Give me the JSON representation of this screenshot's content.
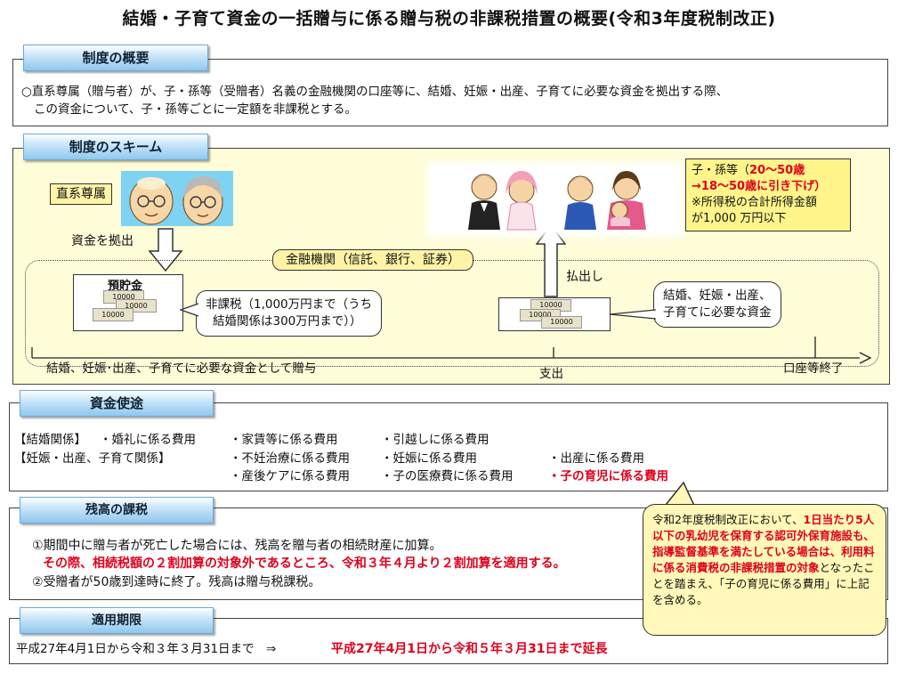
{
  "title": "結婚・子育て資金の一括贈与に係る贈与税の非課税措置の概要(令和3年度税制改正)",
  "overview": {
    "tab": "制度の概要",
    "line1": "○直系尊属（贈与者）が、子・孫等（受贈者）名義の金融機関の口座等に、結婚、妊娠・出産、子育てに必要な資金を拠出する際、",
    "line2": "この資金について、子・孫等ごとに一定額を非課税とする。"
  },
  "scheme": {
    "tab": "制度のスキーム",
    "direct_label": "直系尊属",
    "fund_label": "資金を拠出",
    "bank_label": "金融機関（信託、銀行、証券）",
    "savings_label": "預貯金",
    "bill_text": "10000",
    "nontax_line1": "非課税（1,000万円まで（うち",
    "nontax_line2": "結婚関係は300万円まで））",
    "payout_label": "払出し",
    "needs_line1": "結婚、妊娠・出産、",
    "needs_line2": "子育てに必要な資金",
    "recipient_prefix": "子・孫等（",
    "recipient_age": "20～50歳",
    "recipient_change": "→18～50歳に引き下げ）",
    "recipient_income1": "※所得税の合計所得金額",
    "recipient_income2": "が1,000 万円以下",
    "timeline_gift": "結婚、妊娠･出産、子育てに必要な資金として贈与",
    "timeline_payout": "支出",
    "timeline_end": "口座等終了"
  },
  "uses": {
    "tab": "資金使途",
    "marriage_label": "【結婚関係】",
    "marriage_items": [
      "・婚礼に係る費用",
      "・家賃等に係る費用",
      "・引越しに係る費用"
    ],
    "child_label": "【妊娠・出産、子育て関係】",
    "child_row1": [
      "・不妊治療に係る費用",
      "・妊娠に係る費用",
      "・出産に係る費用"
    ],
    "child_row2": [
      "・産後ケアに係る費用",
      "・子の医療費に係る費用"
    ],
    "child_new": "・子の育児に係る費用"
  },
  "balance": {
    "tab": "残高の課税",
    "item1": "①期間中に贈与者が死亡した場合には、残高を贈与者の相続財産に加算。",
    "item1_red": "その際、相続税額の２割加算の対象外であるところ、令和３年４月より２割加算を適用する。",
    "item2": "②受贈者が50歳到達時に終了。残高は贈与税課税。"
  },
  "period": {
    "tab": "適用期限",
    "text": "平成27年4月1日から令和３年３月31日まで　⇒",
    "extended": "平成27年4月1日から令和５年３月31日まで延長"
  },
  "callout": {
    "p1": "令和2年度税制改正において、",
    "p2_red": "1日当たり5人以下の乳幼児を保育する認可外保育施設も、指導監督基準を満たしている場合は、利用料に係る消費税の非課税措置の対象",
    "p3": "となったことを踏まえ、「子の育児に係る費用」に上記を含める。"
  },
  "colors": {
    "tab_blue": "#8fc7ee",
    "scheme_bg": "#fffdd8",
    "red_text": "#e0001b",
    "note_yellow": "#fff58a"
  }
}
